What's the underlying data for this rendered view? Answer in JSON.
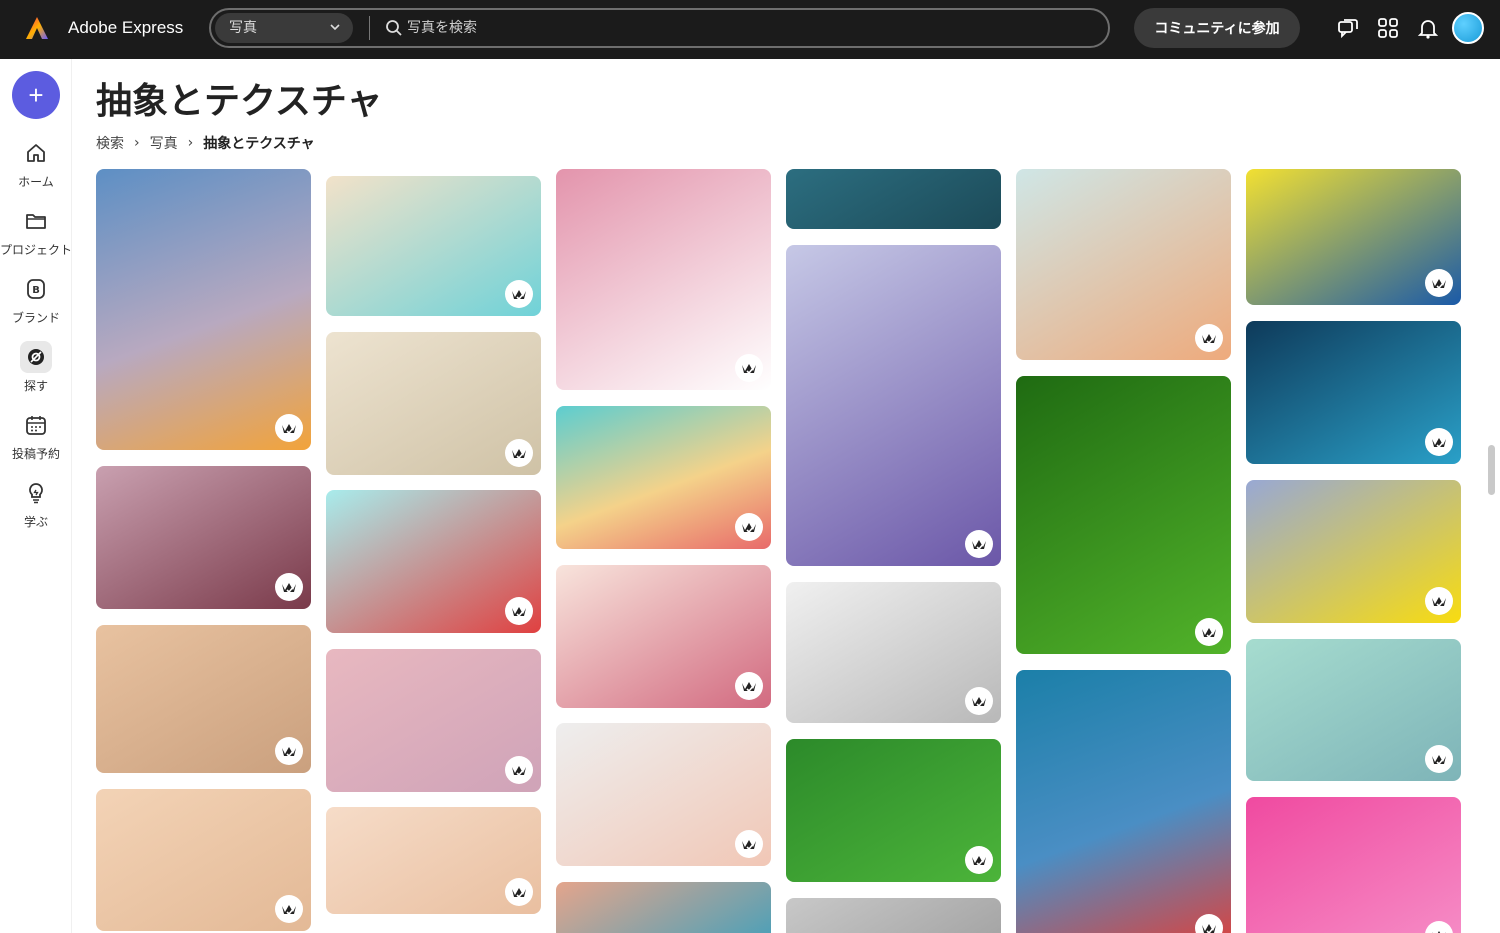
{
  "app": {
    "name": "Adobe Express"
  },
  "search": {
    "scope": "写真",
    "placeholder": "写真を検索"
  },
  "header": {
    "join_label": "コミュニティに参加"
  },
  "sidebar": {
    "items": [
      {
        "label": "ホーム",
        "icon": "home-icon"
      },
      {
        "label": "プロジェクト",
        "icon": "folder-icon"
      },
      {
        "label": "ブランド",
        "icon": "brand-icon"
      },
      {
        "label": "探す",
        "icon": "discover-icon"
      },
      {
        "label": "投稿予約",
        "icon": "calendar-icon"
      },
      {
        "label": "学ぶ",
        "icon": "lightbulb-icon"
      }
    ]
  },
  "page": {
    "title": "抽象とテクスチャ",
    "breadcrumb": [
      "検索",
      "写真",
      "抽象とテクスチャ"
    ]
  },
  "photos": [
    {
      "name": "sunset-sky-photo",
      "colors": [
        "#5d8fc4",
        "#b8a9c0",
        "#f2a33a"
      ]
    },
    {
      "name": "mauve-folds-photo",
      "colors": [
        "#c9a0b0",
        "#7a3a4a"
      ]
    },
    {
      "name": "makeup-smears-photo",
      "colors": [
        "#e8c2a0",
        "#caa07e"
      ]
    },
    {
      "name": "palm-shadow-photo",
      "colors": [
        "#f3d3b6",
        "#e3b996"
      ]
    },
    {
      "name": "beach-sand-photo",
      "colors": [
        "#f2e2c9",
        "#6fd2d8"
      ]
    },
    {
      "name": "wool-fibers-photo",
      "colors": [
        "#ede3d0",
        "#cfc2a6"
      ]
    },
    {
      "name": "strawberries-photo",
      "colors": [
        "#a8ecec",
        "#e04040"
      ]
    },
    {
      "name": "pink-marble-photo",
      "colors": [
        "#e8b8c0",
        "#cfa3b8"
      ]
    },
    {
      "name": "peach-marble-photo",
      "colors": [
        "#f6dcc8",
        "#e9bfa0"
      ]
    },
    {
      "name": "sugar-spoon-photo",
      "colors": [
        "#e394ac",
        "#ffffff"
      ]
    },
    {
      "name": "cake-layers-photo",
      "colors": [
        "#5ccdd0",
        "#f4d28a",
        "#e86a6a"
      ]
    },
    {
      "name": "eyeshadow-swatches-photo",
      "colors": [
        "#f8e4dc",
        "#d26a80"
      ]
    },
    {
      "name": "backpack-photo",
      "colors": [
        "#eeeeee",
        "#f1c7b6"
      ]
    },
    {
      "name": "beach-aerial-photo",
      "colors": [
        "#e4a58c",
        "#4aa0b8"
      ]
    },
    {
      "name": "river-stone-photo",
      "colors": [
        "#2c6e80",
        "#1c4a58"
      ]
    },
    {
      "name": "lavender-balloon-photo",
      "colors": [
        "#c6c8e6",
        "#6b57a8"
      ]
    },
    {
      "name": "white-seats-photo",
      "colors": [
        "#f0f0f0",
        "#b8b8b8"
      ]
    },
    {
      "name": "green-leaf-photo",
      "colors": [
        "#2c8a2a",
        "#4cb43a"
      ]
    },
    {
      "name": "gray-texture-photo",
      "colors": [
        "#c8c8c8",
        "#a0a0a0"
      ]
    },
    {
      "name": "peach-bicycle-photo",
      "colors": [
        "#cfe6e6",
        "#eeaa7c"
      ]
    },
    {
      "name": "arcade-green-photo",
      "colors": [
        "#1f6b12",
        "#52b32a"
      ]
    },
    {
      "name": "blue-flower-photo",
      "colors": [
        "#1b7fa8",
        "#4a8ec4",
        "#e0403a"
      ]
    },
    {
      "name": "yellow-corner-photo",
      "colors": [
        "#f2e032",
        "#1a5aa8"
      ]
    },
    {
      "name": "blue-leaves-photo",
      "colors": [
        "#0e3a5a",
        "#2aa0c8"
      ]
    },
    {
      "name": "puzzle-photo",
      "colors": [
        "#98a8d4",
        "#f8dc10"
      ]
    },
    {
      "name": "popsicle-photo",
      "colors": [
        "#a6dccf",
        "#7eb4b8"
      ]
    },
    {
      "name": "pink-bubbles-photo",
      "colors": [
        "#f04aa0",
        "#f690c8"
      ]
    }
  ]
}
